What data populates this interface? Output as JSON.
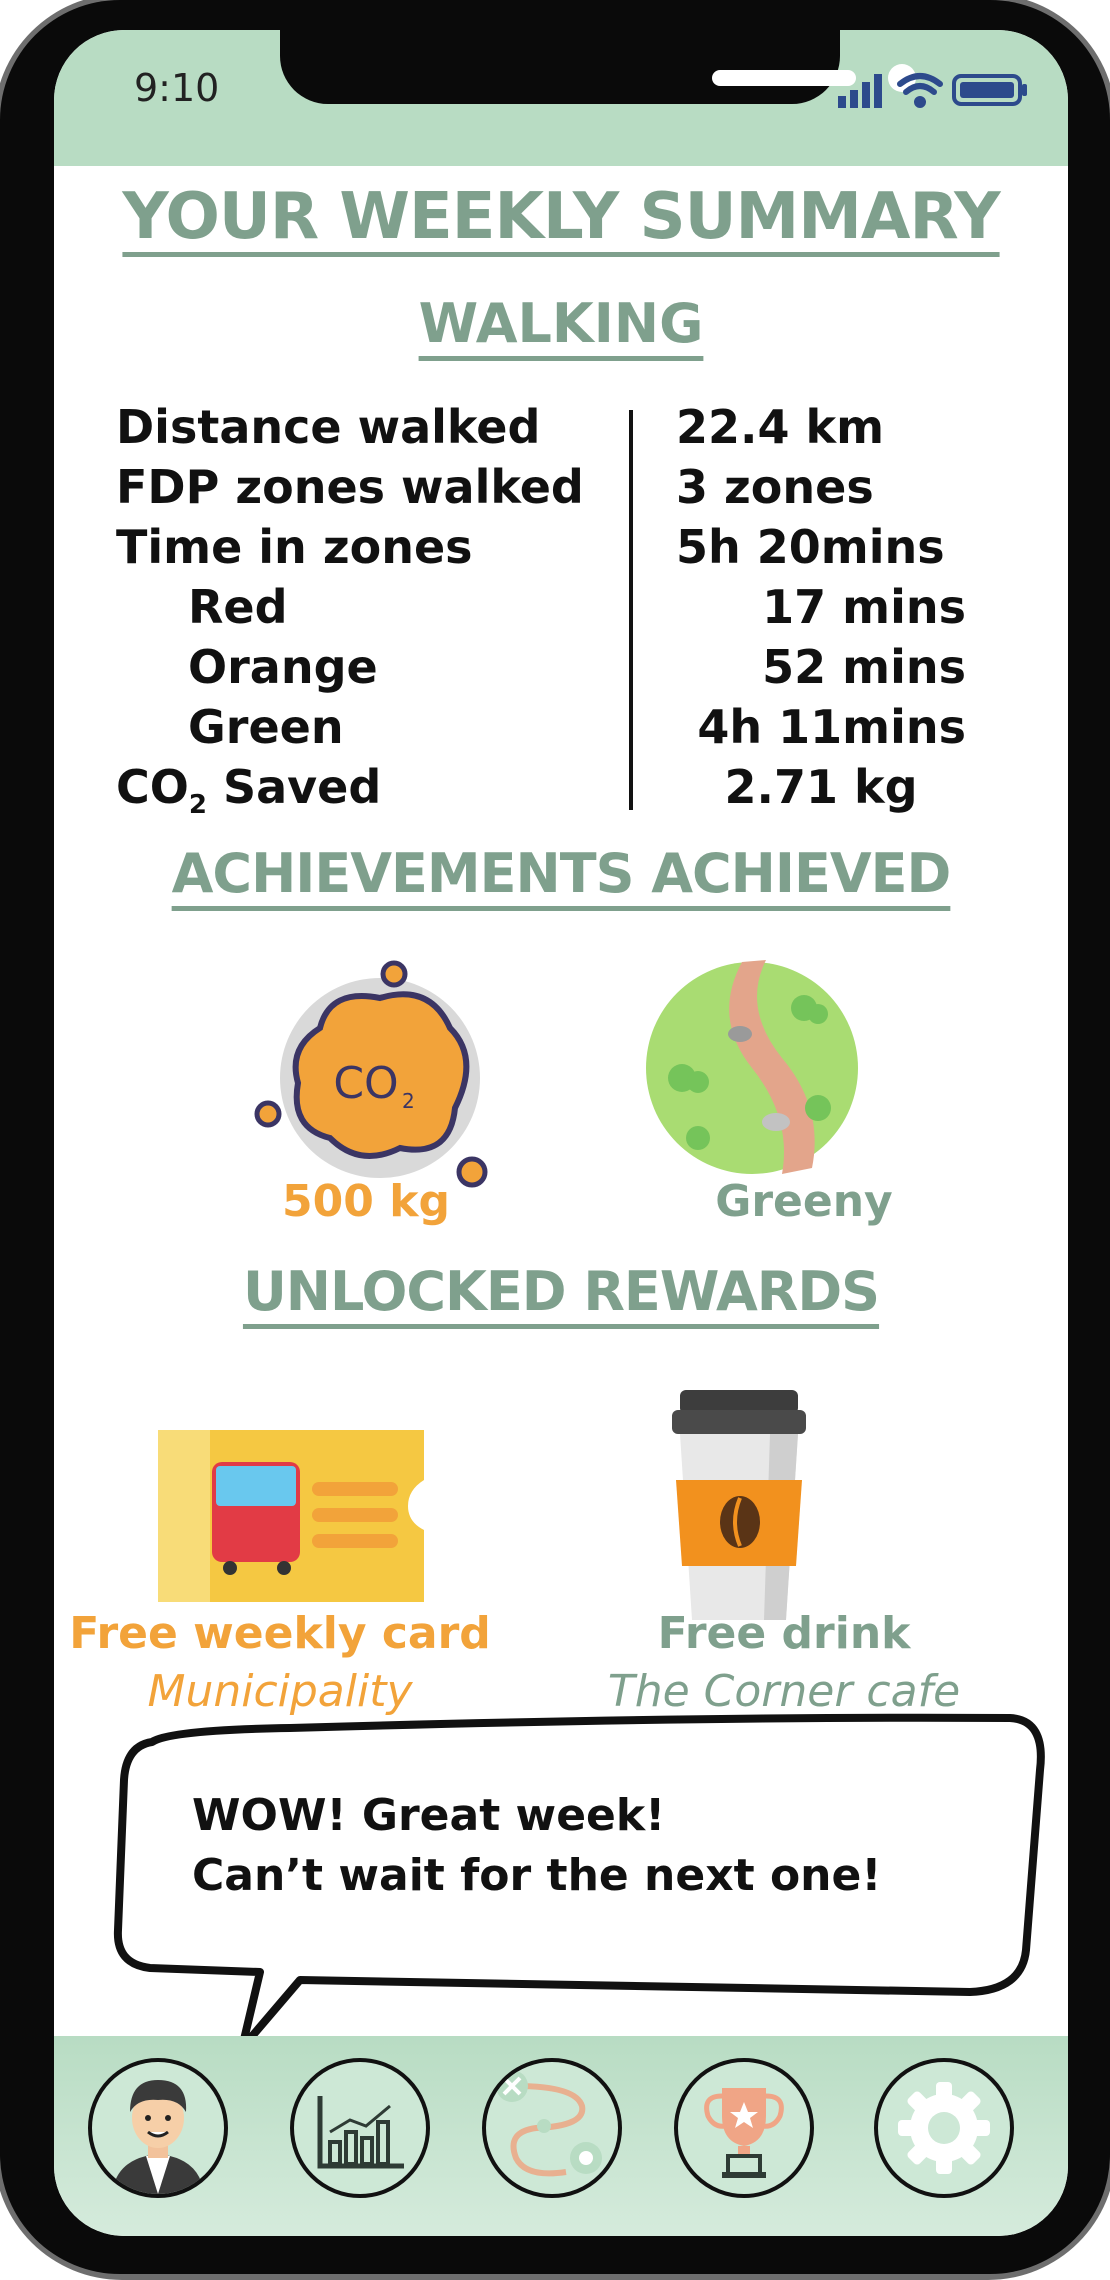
{
  "status_bar": {
    "time": "9:10"
  },
  "header": {
    "title": "YOUR WEEKLY SUMMARY",
    "section": "WALKING"
  },
  "stats": [
    {
      "label": "Distance walked",
      "value": "22.4 km",
      "indent": false
    },
    {
      "label": "FDP zones walked",
      "value": "3 zones",
      "indent": false
    },
    {
      "label": "Time in zones",
      "value": "5h 20mins",
      "indent": false
    },
    {
      "label": "Red",
      "value": "17 mins",
      "indent": true
    },
    {
      "label": "Orange",
      "value": "52 mins",
      "indent": true
    },
    {
      "label": "Green",
      "value": "4h 11mins",
      "indent": true
    }
  ],
  "co2": {
    "label_prefix": "CO",
    "label_sub": "2",
    "label_suffix": " Saved",
    "value": "2.71 kg"
  },
  "achievements": {
    "title": "ACHIEVEMENTS ACHIEVED",
    "items": [
      {
        "label": "500 kg",
        "icon": "co2-cloud-icon",
        "icon_text": "CO",
        "icon_sub": "2"
      },
      {
        "label": "Greeny",
        "icon": "green-path-icon"
      }
    ]
  },
  "rewards": {
    "title": "UNLOCKED REWARDS",
    "items": [
      {
        "title": "Free weekly card",
        "subtitle": "Municipality",
        "icon": "bus-ticket-icon"
      },
      {
        "title": "Free drink",
        "subtitle": "The Corner cafe",
        "icon": "coffee-cup-icon"
      }
    ]
  },
  "message": {
    "line1": "WOW! Great week!",
    "line2": "Can’t wait for the next one!"
  },
  "nav": [
    "avatar-icon",
    "chart-icon",
    "map-route-icon",
    "trophy-icon",
    "gear-icon"
  ],
  "colors": {
    "accent_green": "#7fa08d",
    "accent_orange": "#f2a33a",
    "mint": "#b8dcc3"
  }
}
